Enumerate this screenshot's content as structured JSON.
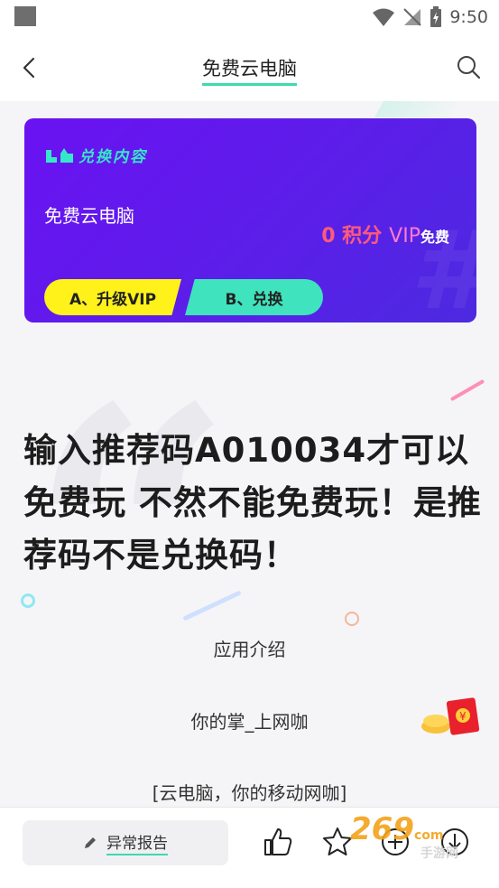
{
  "status_bar": {
    "time": "9:50"
  },
  "nav": {
    "title": "免费云电脑"
  },
  "promo_card": {
    "header": "兑换内容",
    "subtitle": "免费云电脑",
    "points": "0 积分",
    "vip": "VIP",
    "free": "免费",
    "option_a": "A、升级VIP",
    "option_b": "B、兑换"
  },
  "headline": "输入推荐码A010034才可以免费玩 不然不能免费玩！是推荐码不是兑换码！",
  "sections": {
    "intro": "应用介绍",
    "tagline": "你的掌_上网咖",
    "desc": "[云电脑，你的移动网咖]"
  },
  "bottom_bar": {
    "report_label": "异常报告",
    "watermark_logo": "269",
    "watermark_domain": "com",
    "watermark_sub": "手游网"
  },
  "colors": {
    "accent": "#3fd9b0",
    "card": "#5a1fe8",
    "option_a": "#fff21a",
    "option_b": "#3fe3bd"
  },
  "icons": [
    "back-icon",
    "search-icon",
    "pencil-icon",
    "like-icon",
    "star-icon",
    "add-icon",
    "download-icon"
  ]
}
